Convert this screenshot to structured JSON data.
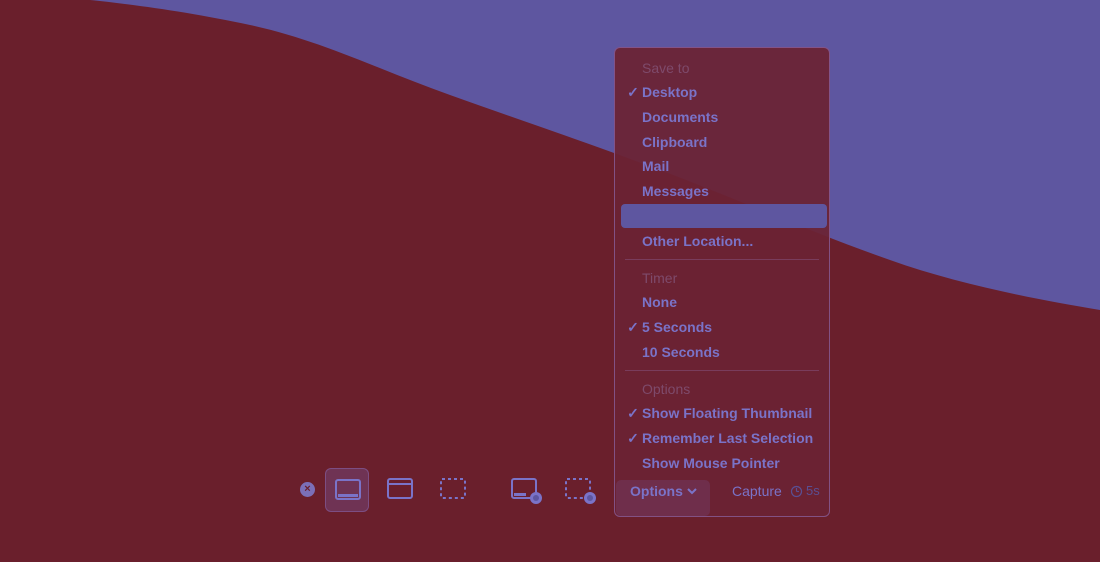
{
  "menu": {
    "save_to_header": "Save to",
    "save_to_items": [
      {
        "label": "Desktop",
        "checked": true
      },
      {
        "label": "Documents",
        "checked": false
      },
      {
        "label": "Clipboard",
        "checked": false
      },
      {
        "label": "Mail",
        "checked": false
      },
      {
        "label": "Messages",
        "checked": false
      },
      {
        "label": "",
        "checked": false
      },
      {
        "label": "Other Location...",
        "checked": false
      }
    ],
    "timer_header": "Timer",
    "timer_items": [
      {
        "label": "None",
        "checked": false
      },
      {
        "label": "5 Seconds",
        "checked": true
      },
      {
        "label": "10 Seconds",
        "checked": false
      }
    ],
    "options_header": "Options",
    "options_items": [
      {
        "label": "Show Floating Thumbnail",
        "checked": true
      },
      {
        "label": "Remember Last Selection",
        "checked": true
      },
      {
        "label": "Show Mouse Pointer",
        "checked": false
      }
    ],
    "check_glyph": "✓"
  },
  "toolbar": {
    "close_glyph": "×",
    "options_label": "Options",
    "capture_label": "Capture",
    "timer_value": "5s"
  },
  "colors": {
    "background": "#6a1f2c",
    "wallpaper_wave": "#5e56a0",
    "accent_text": "#7a73c8",
    "highlight": "#5e56a0"
  }
}
